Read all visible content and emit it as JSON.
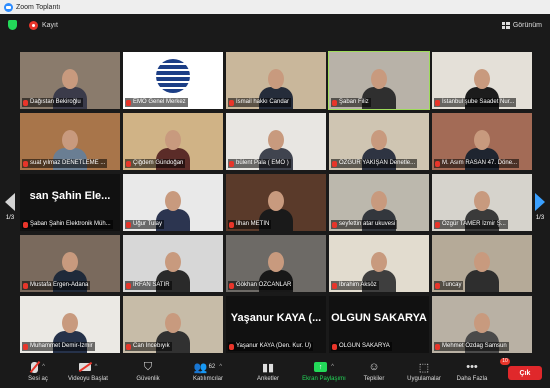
{
  "window": {
    "title": "Zoom Toplantı"
  },
  "status": {
    "record_label": "Kayıt",
    "view_label": "Görünüm"
  },
  "pager": {
    "left": "1/3",
    "right": "1/3"
  },
  "participants": [
    {
      "name": "Dağıstan Bekiroğlu",
      "bg": "#8a7b6c",
      "shirt": "#3b3b4a",
      "type": "video"
    },
    {
      "name": "EMO Genel Merkez",
      "bg": "#ffffff",
      "shirt": "",
      "type": "logo"
    },
    {
      "name": "İsmail hakkı Candar",
      "bg": "#c9b79b",
      "shirt": "#252c3a",
      "type": "video"
    },
    {
      "name": "Şaban Filiz",
      "bg": "#b8b2a8",
      "shirt": "#2f2f2f",
      "type": "video"
    },
    {
      "name": "İstanbul şube Saadet Nur...",
      "bg": "#e4e0d8",
      "shirt": "#1c1c1c",
      "type": "video"
    },
    {
      "name": "suat yılmaz DENETLEME ...",
      "bg": "#a8754a",
      "shirt": "#6a7e93",
      "type": "video"
    },
    {
      "name": "Çiğdem Gündoğan",
      "bg": "#d0b386",
      "shirt": "#5b2c28",
      "type": "video"
    },
    {
      "name": "bülent Pala ( EMO )",
      "bg": "#e8e6e2",
      "shirt": "#40444f",
      "type": "video"
    },
    {
      "name": "ÖZGÜR YAKIŞAN Denetle...",
      "bg": "#cfc5b2",
      "shirt": "#2e3442",
      "type": "video"
    },
    {
      "name": "M. Asım RASAN 47. Döne...",
      "bg": "#a36b56",
      "shirt": "#1f2530",
      "type": "video"
    },
    {
      "name": "Şaban Şahin Elektronik Müh...",
      "big": "san Şahin Ele...",
      "bg": "#111111",
      "shirt": "",
      "type": "text"
    },
    {
      "name": "Uğur Tulay",
      "bg": "#e9e9e9",
      "shirt": "#2c3550",
      "type": "video"
    },
    {
      "name": "İlhan METİN",
      "bg": "#5a3a2a",
      "shirt": "#1a1a1a",
      "type": "video"
    },
    {
      "name": "seyfettin atar ukuvesi",
      "bg": "#bcb8ad",
      "shirt": "#33373d",
      "type": "video"
    },
    {
      "name": "Özgür TAMER İzmir Ş...",
      "bg": "#d6d3cc",
      "shirt": "#3a3a3a",
      "type": "video"
    },
    {
      "name": "Mustafa Ergen-Adana",
      "bg": "#7a6a5d",
      "shirt": "#1f2a3a",
      "type": "video"
    },
    {
      "name": "İRFAN SATIR",
      "bg": "#d7d7d7",
      "shirt": "#2a2a2a",
      "type": "video"
    },
    {
      "name": "Gökhan ÖZCANLAR",
      "bg": "#6d6a66",
      "shirt": "#181818",
      "type": "video"
    },
    {
      "name": "İbrahim Aksöz",
      "bg": "#e2dccf",
      "shirt": "#3e3e3e",
      "type": "video"
    },
    {
      "name": "Tuncay",
      "bg": "#b5aa98",
      "shirt": "#2e2e2e",
      "type": "video"
    },
    {
      "name": "Muhammet Demir-İzmir",
      "bg": "#ebe9e4",
      "shirt": "#26324a",
      "type": "video"
    },
    {
      "name": "Can İncebıyık",
      "bg": "#c7bca8",
      "shirt": "#313131",
      "type": "video"
    },
    {
      "name": "Yaşanur KAYA (Den. Kur. Ü)",
      "big": "Yaşanur KAYA (...",
      "bg": "#111111",
      "shirt": "",
      "type": "text"
    },
    {
      "name": "OLGUN SAKARYA",
      "big": "OLGUN SAKARYA",
      "bg": "#111111",
      "shirt": "",
      "type": "text"
    },
    {
      "name": "Mehmet Ozdag Samsun",
      "bg": "#b9b1a4",
      "shirt": "#4a4a4a",
      "type": "video"
    }
  ],
  "toolbar": {
    "mute": "Sesi aç",
    "video": "Videoyu Başlat",
    "security": "Güvenlik",
    "participants": "Katılımcılar",
    "participants_count": "62",
    "polls": "Anketler",
    "share": "Ekran Paylaşımı",
    "reactions": "Tepkiler",
    "apps": "Uygulamalar",
    "more": "Daha Fazla",
    "more_badge": "10",
    "end": "Çık"
  },
  "colors": {
    "accent": "#2d8cff",
    "active_speaker": "#9fdc5b",
    "end": "#e0282b",
    "muted": "#e8352a"
  }
}
